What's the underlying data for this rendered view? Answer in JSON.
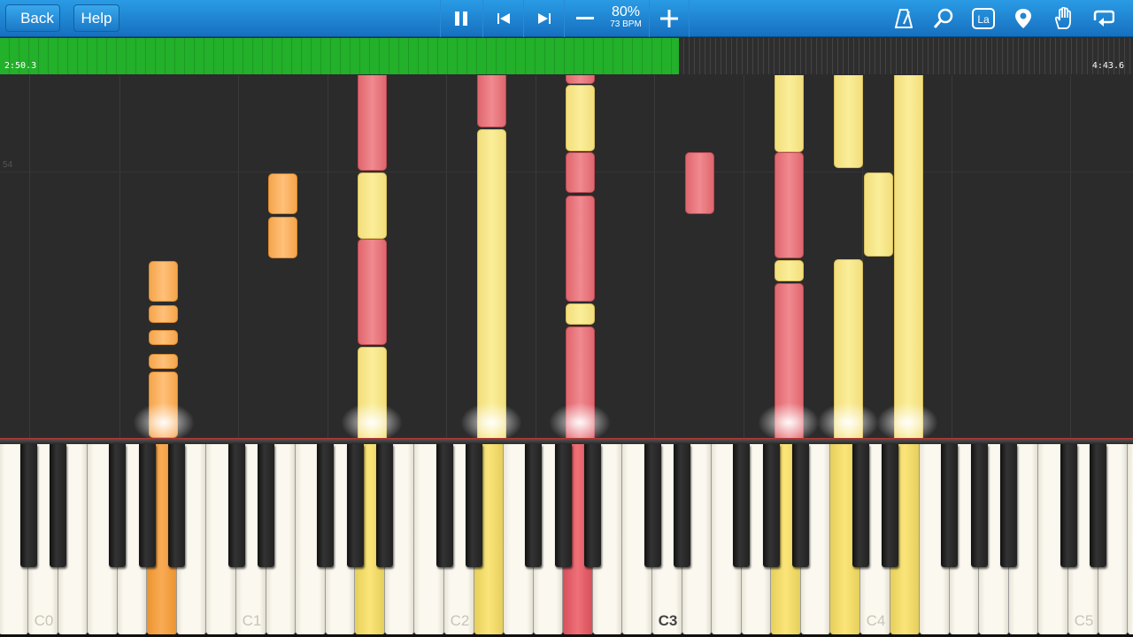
{
  "toolbar": {
    "back_label": "Back",
    "help_label": "Help",
    "speed_percent": "80%",
    "tempo": "73 BPM",
    "icons": [
      "pause-icon",
      "previous-icon",
      "next-icon",
      "speed-down-icon",
      "speed-up-icon",
      "metronome-icon",
      "zoom-icon",
      "key-labels-icon",
      "location-marker-icon",
      "hand-icon",
      "loop-icon"
    ]
  },
  "timeline": {
    "current_time": "2:50.3",
    "total_time": "4:43.6",
    "progress": 0.6
  },
  "roll": {
    "measure_number": "54"
  },
  "keyboard": {
    "octave_labels": [
      "C0",
      "C1",
      "C2",
      "C3",
      "C4",
      "C5"
    ]
  },
  "colors": {
    "toolbar": "#1f88d6",
    "progress": "#23b02a",
    "note_yellow": "#fbee9a",
    "note_red": "#f08a90",
    "note_orange": "#ffc07a"
  }
}
